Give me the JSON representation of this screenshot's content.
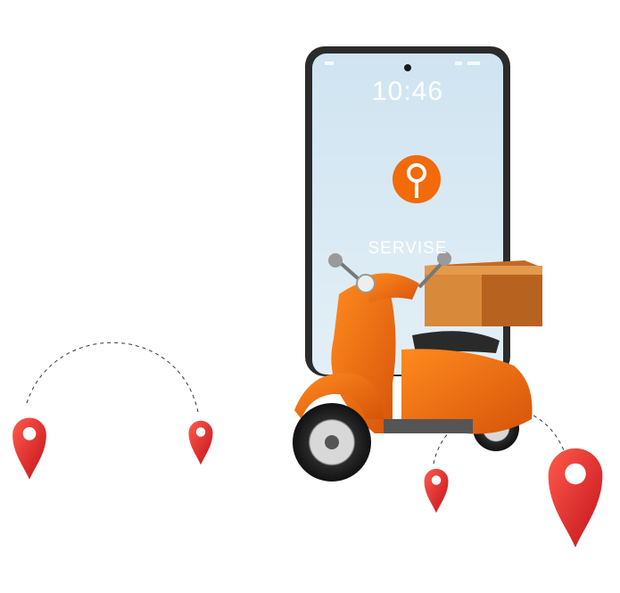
{
  "phone": {
    "time": "10:46",
    "brand_label": "SERVISE",
    "app_icon": "location-pin-icon",
    "screen_color": "#d8e9f3",
    "frame_color": "#2b2b2b"
  },
  "scooter": {
    "body_color": "#f26a0a",
    "box_color": "#d9893a",
    "icon": "scooter-icon"
  },
  "markers": {
    "icon": "map-pin-icon",
    "color": "#e8262a"
  }
}
